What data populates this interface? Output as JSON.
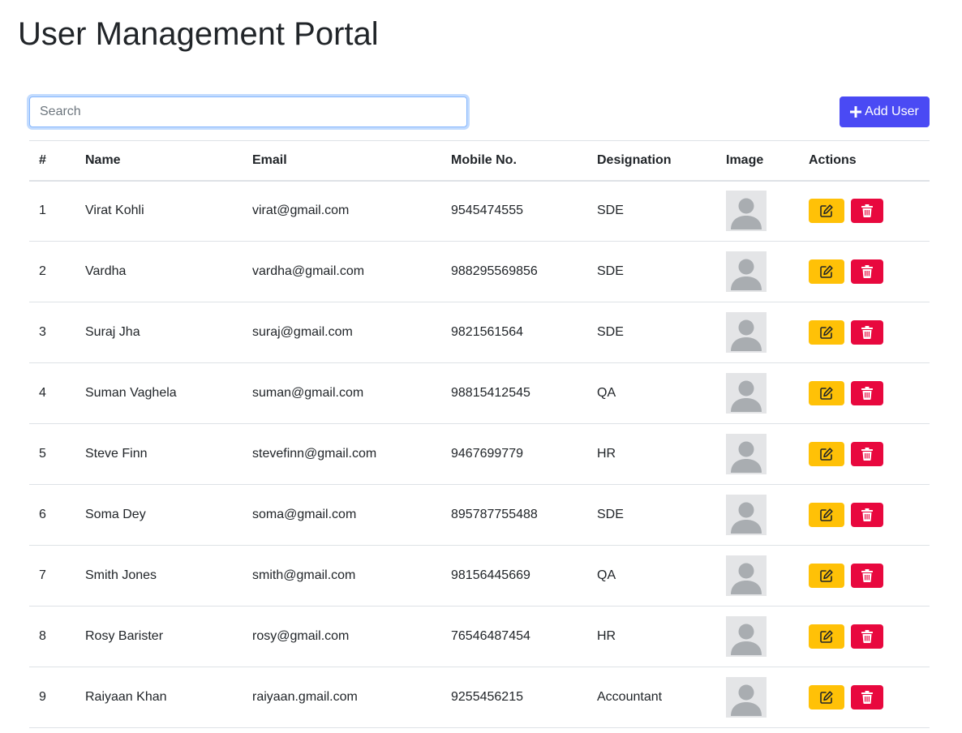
{
  "header": {
    "title": "User Management Portal"
  },
  "toolbar": {
    "search_placeholder": "Search",
    "search_value": "",
    "add_user_label": "Add User"
  },
  "colors": {
    "primary": "#4a4af4",
    "edit": "#ffc107",
    "delete": "#e8083e"
  },
  "table": {
    "columns": [
      "#",
      "Name",
      "Email",
      "Mobile No.",
      "Designation",
      "Image",
      "Actions"
    ],
    "rows": [
      {
        "id": "1",
        "name": "Virat Kohli",
        "email": "virat@gmail.com",
        "mobile": "9545474555",
        "designation": "SDE"
      },
      {
        "id": "2",
        "name": "Vardha",
        "email": "vardha@gmail.com",
        "mobile": "988295569856",
        "designation": "SDE"
      },
      {
        "id": "3",
        "name": "Suraj Jha",
        "email": "suraj@gmail.com",
        "mobile": "9821561564",
        "designation": "SDE"
      },
      {
        "id": "4",
        "name": "Suman Vaghela",
        "email": "suman@gmail.com",
        "mobile": "98815412545",
        "designation": "QA"
      },
      {
        "id": "5",
        "name": "Steve Finn",
        "email": "stevefinn@gmail.com",
        "mobile": "9467699779",
        "designation": "HR"
      },
      {
        "id": "6",
        "name": "Soma Dey",
        "email": "soma@gmail.com",
        "mobile": "895787755488",
        "designation": "SDE"
      },
      {
        "id": "7",
        "name": "Smith Jones",
        "email": "smith@gmail.com",
        "mobile": "98156445669",
        "designation": "QA"
      },
      {
        "id": "8",
        "name": "Rosy Barister",
        "email": "rosy@gmail.com",
        "mobile": "76546487454",
        "designation": "HR"
      },
      {
        "id": "9",
        "name": "Raiyaan Khan",
        "email": "raiyaan.gmail.com",
        "mobile": "9255456215",
        "designation": "Accountant"
      }
    ],
    "row_icons": {
      "image": "avatar-placeholder-icon",
      "edit": "edit-icon",
      "delete": "trash-icon"
    }
  }
}
